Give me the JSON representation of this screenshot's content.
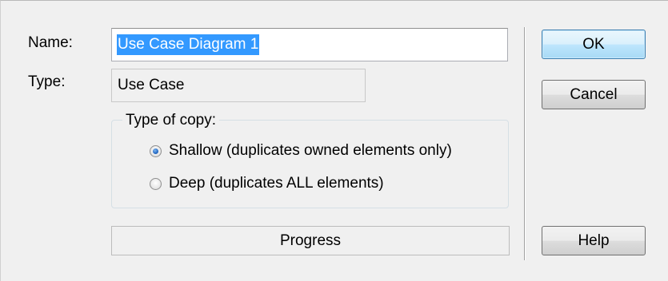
{
  "dialog": {
    "name_label": "Name:",
    "name_value": "Use Case Diagram 1",
    "type_label": "Type:",
    "type_value": "Use Case",
    "copy_group": {
      "legend": "Type of copy:",
      "options": [
        {
          "label": "Shallow (duplicates owned elements only)",
          "checked": true
        },
        {
          "label": "Deep (duplicates ALL elements)",
          "checked": false
        }
      ]
    },
    "progress_label": "Progress"
  },
  "buttons": {
    "ok": "OK",
    "cancel": "Cancel",
    "help": "Help"
  },
  "colors": {
    "selection": "#3399ff",
    "default_button": "#bee6fd",
    "background": "#f0f0f0"
  }
}
